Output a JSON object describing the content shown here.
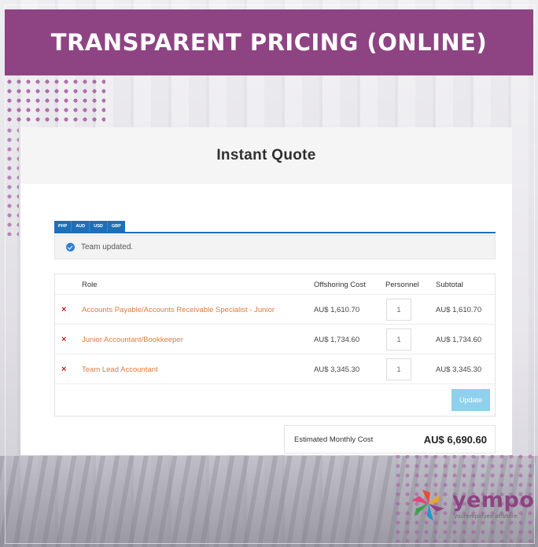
{
  "banner": {
    "title": "TRANSPARENT PRICING (ONLINE)"
  },
  "quote": {
    "title": "Instant Quote",
    "currency_tabs": [
      "PHP",
      "AUD",
      "USD",
      "GBP"
    ],
    "alert": "Team updated.",
    "columns": {
      "role": "Role",
      "cost": "Offshoring Cost",
      "personnel": "Personnel",
      "subtotal": "Subtotal"
    },
    "rows": [
      {
        "role": "Accounts Payable/Accounts Receivable Specialist - Junior",
        "cost": "AU$  1,610.70",
        "personnel": "1",
        "subtotal": "AU$  1,610.70"
      },
      {
        "role": "Junior Accountant/Bookkeeper",
        "cost": "AU$  1,734.60",
        "personnel": "1",
        "subtotal": "AU$  1,734.60"
      },
      {
        "role": "Team Lead Accountant",
        "cost": "AU$  3,345.30",
        "personnel": "1",
        "subtotal": "AU$  3,345.30"
      }
    ],
    "remove_symbol": "×",
    "update_label": "Update",
    "total_label": "Estimated Monthly Cost",
    "total_value": "AU$  6,690.60"
  },
  "logo": {
    "word": "yempo",
    "tagline": "youremployee offshore"
  },
  "colors": {
    "banner": "#8e4383",
    "tab": "#1e6fb8",
    "link": "#e07a3c",
    "remove": "#d11b1b",
    "update": "#8fd0ec"
  }
}
